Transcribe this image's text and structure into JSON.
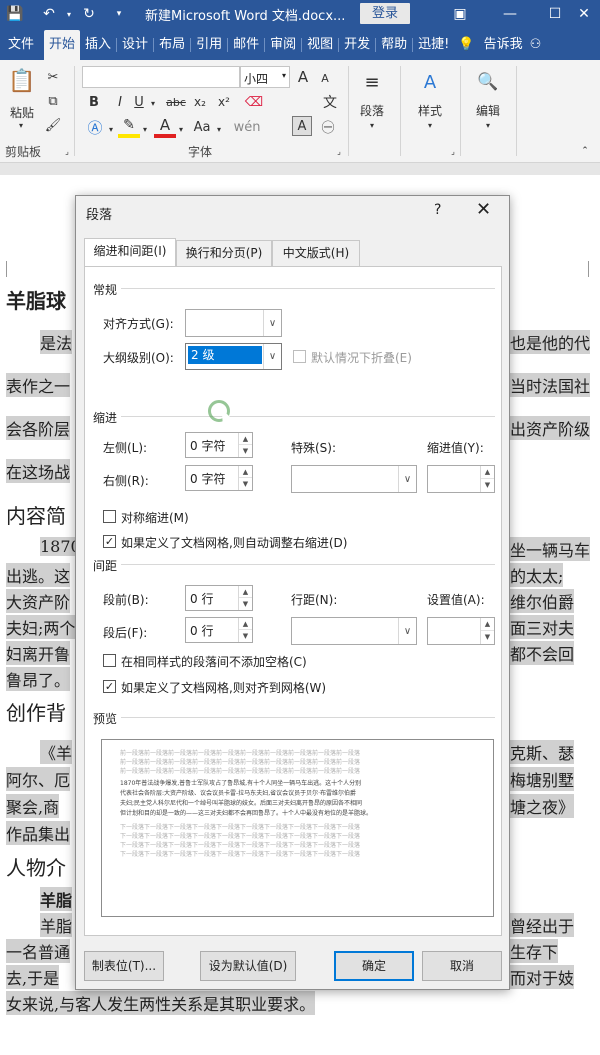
{
  "titlebar": {
    "doc_title": "新建Microsoft Word 文档.docx...",
    "login": "登录"
  },
  "tabs": [
    "文件",
    "开始",
    "插入",
    "设计",
    "布局",
    "引用",
    "邮件",
    "审阅",
    "视图",
    "开发",
    "帮助",
    "迅捷!",
    "告诉我"
  ],
  "ribbon": {
    "paste": "粘贴",
    "clipboard": "剪贴板",
    "font_size": "小四",
    "font_group": "字体",
    "paragraph": "段落",
    "styles": "样式",
    "editing": "编辑",
    "bold": "B",
    "italic": "I",
    "underline": "U",
    "strike": "abc",
    "sub": "x₂",
    "sup": "x²",
    "font_color": "A",
    "aa": "Aa",
    "grow": "A",
    "shrink": "A",
    "phonetic": "wén",
    "border_char": "A"
  },
  "document": {
    "lines": [
      "羊脂球",
      "是法",
      "也是他的代",
      "表作之一",
      "当时法国社",
      "会各阶层",
      "出资产阶级",
      "在这场战",
      "内容简",
      "1870",
      "坐一辆马车",
      "出逃。这",
      "的太太;",
      "大资产阶",
      "维尔伯爵",
      "夫妇;两个",
      "面三对夫",
      "妇离开鲁",
      "都不会回",
      "鲁昂了。",
      "创作背",
      "《羊",
      "克斯、瑟",
      "阿尔、厄",
      "梅塘别墅",
      "聚会,商",
      "塘之夜》",
      "作品集出",
      "人物介",
      "羊脂",
      "羊脂",
      "曾经出于",
      "一名普通",
      "生存下",
      "去,于是",
      "而对于妓",
      "女来说,与客人发生两性关系是其职业要求。"
    ]
  },
  "dialog": {
    "title": "段落",
    "help": "?",
    "tabs": [
      "缩进和间距(I)",
      "换行和分页(P)",
      "中文版式(H)"
    ],
    "general": "常规",
    "alignment_label": "对齐方式(G):",
    "alignment_value": "",
    "outline_label": "大纲级别(O):",
    "outline_value": "2 级",
    "collapse_label": "默认情况下折叠(E)",
    "indent": "缩进",
    "left_label": "左侧(L):",
    "left_value": "0 字符",
    "right_label": "右侧(R):",
    "right_value": "0 字符",
    "special_label": "特殊(S):",
    "indent_value_label": "缩进值(Y):",
    "mirror_label": "对称缩进(M)",
    "auto_right_label": "如果定义了文档网格,则自动调整右缩进(D)",
    "spacing": "间距",
    "before_label": "段前(B):",
    "before_value": "0 行",
    "after_label": "段后(F):",
    "after_value": "0 行",
    "line_spacing_label": "行距(N):",
    "set_value_label": "设置值(A):",
    "no_space_label": "在相同样式的段落间不添加空格(C)",
    "snap_grid_label": "如果定义了文档网格,则对齐到网格(W)",
    "preview": "预览",
    "preview_prev": "前一段落前一段落前一段落前一段落前一段落前一段落前一段落前一段落前一段落前一段落",
    "preview_text_1": "1870年普法战争爆发,普鲁士军队攻占了鲁昂城,有十个人同坐一辆马车出逃。这十个人分别",
    "preview_text_2": "代表社会各阶层:大资产阶级、议会议员卡雷-拉马东夫妇,省议会议员于贝尔·布雷维尔伯爵",
    "preview_text_3": "夫妇;民主党人科尔尼代和一个绰号叫羊脂球的妓女。后面三对夫妇离开鲁昂的原因各不相同",
    "preview_text_4": "但计划和目的却是一致的——这三对夫妇都不会再回鲁昂了。十个人中最没有地位的是羊脂球。",
    "preview_next": "下一段落下一段落下一段落下一段落下一段落下一段落下一段落下一段落下一段落下一段落",
    "tabs_button": "制表位(T)...",
    "default_button": "设为默认值(D)",
    "ok_button": "确定",
    "cancel_button": "取消"
  }
}
